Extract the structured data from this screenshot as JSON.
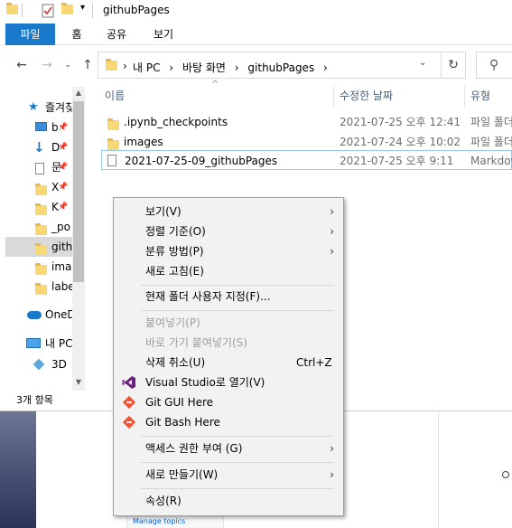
{
  "window": {
    "title": "githubPages"
  },
  "ribbon": {
    "tabs": [
      {
        "label": "파일"
      },
      {
        "label": "홈"
      },
      {
        "label": "공유"
      },
      {
        "label": "보기"
      }
    ]
  },
  "address": {
    "crumbs": [
      "내 PC",
      "바탕 화면",
      "githubPages"
    ],
    "separator": "›"
  },
  "nav": {
    "items": [
      {
        "label": "즐겨찾기",
        "icon": "star-icon"
      },
      {
        "label": "b",
        "icon": "desktop-icon"
      },
      {
        "label": "D",
        "icon": "download-icon"
      },
      {
        "label": "문",
        "icon": "document-icon"
      },
      {
        "label": "X",
        "icon": "folder-icon"
      },
      {
        "label": "K",
        "icon": "folder-icon"
      },
      {
        "label": "_po",
        "icon": "folder-icon"
      },
      {
        "label": "githu",
        "icon": "folder-icon"
      },
      {
        "label": "ima",
        "icon": "folder-icon"
      },
      {
        "label": "labe",
        "icon": "folder-icon"
      },
      {
        "label": "OneD",
        "icon": "cloud-icon"
      },
      {
        "label": "내 PC",
        "icon": "pc-icon"
      },
      {
        "label": "3D",
        "icon": "3d-objects-icon"
      }
    ]
  },
  "files": {
    "columns": {
      "name": "이름",
      "modified": "수정한 날짜",
      "type": "유형"
    },
    "rows": [
      {
        "name": ".ipynb_checkpoints",
        "modified": "2021-07-25 오후 12:41",
        "type": "파일 폴더",
        "icon": "folder-icon"
      },
      {
        "name": "images",
        "modified": "2021-07-24 오후 10:02",
        "type": "파일 폴더",
        "icon": "folder-icon"
      },
      {
        "name": "2021-07-25-09_githubPages",
        "modified": "2021-07-25 오후 9:11",
        "type": "Markdown",
        "icon": "document-icon"
      }
    ]
  },
  "status": {
    "count": "3개 항목"
  },
  "context_menu": {
    "items": [
      {
        "label": "보기(V)",
        "submenu": true
      },
      {
        "label": "정렬 기준(O)",
        "submenu": true
      },
      {
        "label": "분류 방법(P)",
        "submenu": true
      },
      {
        "label": "새로 고침(E)"
      },
      {
        "label": "현재 폴더 사용자 지정(F)..."
      },
      {
        "label": "붙여넣기(P)",
        "disabled": true
      },
      {
        "label": "바로 가기 붙여넣기(S)",
        "disabled": true
      },
      {
        "label": "삭제 취소(U)",
        "shortcut": "Ctrl+Z"
      },
      {
        "label": "Visual Studio로 열기(V)",
        "icon": "visual-studio-icon"
      },
      {
        "label": "Git GUI Here",
        "icon": "git-icon"
      },
      {
        "label": "Git Bash Here",
        "icon": "git-icon"
      },
      {
        "label": "액세스 권한 부여 (G)",
        "submenu": true
      },
      {
        "label": "새로 만들기(W)",
        "submenu": true
      },
      {
        "label": "속성(R)"
      }
    ],
    "submenu_glyph": "›"
  },
  "background": {
    "manage_topics": "Manage topics"
  },
  "colors": {
    "file_tab": "#1979ca",
    "folder": "#f8d775",
    "menu_bg": "#f2f2f2",
    "vs_purple": "#68217a",
    "git_red": "#f05133"
  }
}
